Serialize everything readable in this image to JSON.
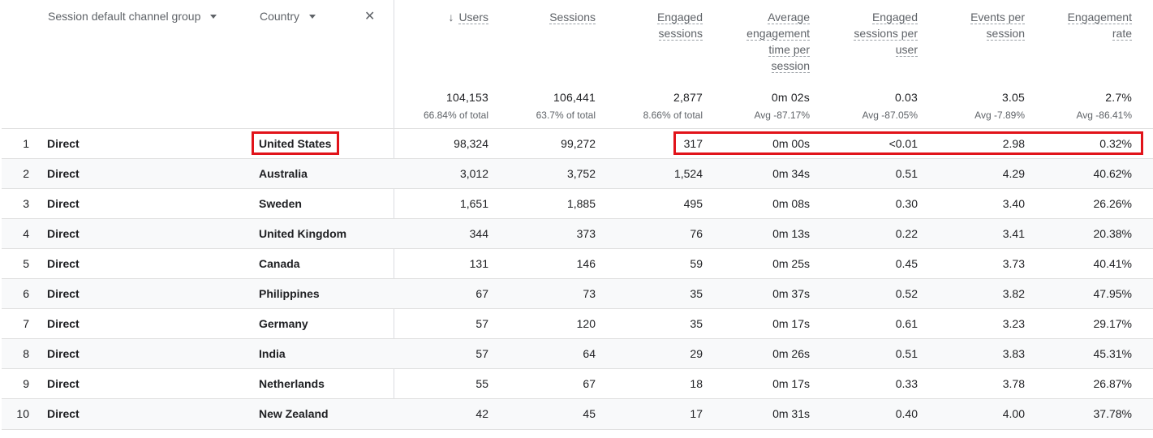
{
  "dimensions": {
    "primary": "Session default channel group",
    "secondary": "Country",
    "remove_icon": "close-icon",
    "dropdown_icon": "caret-down-icon",
    "sort_icon": "arrow-down-icon"
  },
  "metrics": [
    {
      "lines": [
        "Users"
      ],
      "total": "104,153",
      "sub": "66.84% of total"
    },
    {
      "lines": [
        "Sessions"
      ],
      "total": "106,441",
      "sub": "63.7% of total"
    },
    {
      "lines": [
        "Engaged",
        "sessions"
      ],
      "total": "2,877",
      "sub": "8.66% of total"
    },
    {
      "lines": [
        "Average",
        "engagement",
        "time per",
        "session"
      ],
      "total": "0m 02s",
      "sub": "Avg -87.17%"
    },
    {
      "lines": [
        "Engaged",
        "sessions per",
        "user"
      ],
      "total": "0.03",
      "sub": "Avg -87.05%"
    },
    {
      "lines": [
        "Events per",
        "session"
      ],
      "total": "3.05",
      "sub": "Avg -7.89%"
    },
    {
      "lines": [
        "Engagement",
        "rate"
      ],
      "total": "2.7%",
      "sub": "Avg -86.41%"
    }
  ],
  "rows": [
    {
      "idx": "1",
      "channel": "Direct",
      "country": "United States",
      "values": [
        "98,324",
        "99,272",
        "317",
        "0m 00s",
        "<0.01",
        "2.98",
        "0.32%"
      ]
    },
    {
      "idx": "2",
      "channel": "Direct",
      "country": "Australia",
      "values": [
        "3,012",
        "3,752",
        "1,524",
        "0m 34s",
        "0.51",
        "4.29",
        "40.62%"
      ]
    },
    {
      "idx": "3",
      "channel": "Direct",
      "country": "Sweden",
      "values": [
        "1,651",
        "1,885",
        "495",
        "0m 08s",
        "0.30",
        "3.40",
        "26.26%"
      ]
    },
    {
      "idx": "4",
      "channel": "Direct",
      "country": "United Kingdom",
      "values": [
        "344",
        "373",
        "76",
        "0m 13s",
        "0.22",
        "3.41",
        "20.38%"
      ]
    },
    {
      "idx": "5",
      "channel": "Direct",
      "country": "Canada",
      "values": [
        "131",
        "146",
        "59",
        "0m 25s",
        "0.45",
        "3.73",
        "40.41%"
      ]
    },
    {
      "idx": "6",
      "channel": "Direct",
      "country": "Philippines",
      "values": [
        "67",
        "73",
        "35",
        "0m 37s",
        "0.52",
        "3.82",
        "47.95%"
      ]
    },
    {
      "idx": "7",
      "channel": "Direct",
      "country": "Germany",
      "values": [
        "57",
        "120",
        "35",
        "0m 17s",
        "0.61",
        "3.23",
        "29.17%"
      ]
    },
    {
      "idx": "8",
      "channel": "Direct",
      "country": "India",
      "values": [
        "57",
        "64",
        "29",
        "0m 26s",
        "0.51",
        "3.83",
        "45.31%"
      ]
    },
    {
      "idx": "9",
      "channel": "Direct",
      "country": "Netherlands",
      "values": [
        "55",
        "67",
        "18",
        "0m 17s",
        "0.33",
        "3.78",
        "26.87%"
      ]
    },
    {
      "idx": "10",
      "channel": "Direct",
      "country": "New Zealand",
      "values": [
        "42",
        "45",
        "17",
        "0m 31s",
        "0.40",
        "4.00",
        "37.78%"
      ]
    }
  ],
  "colors": {
    "highlight": "#e1131a",
    "row_shade": "#f8f9fa",
    "grid_line": "#e0e0e0",
    "muted_text": "#5f6368"
  }
}
